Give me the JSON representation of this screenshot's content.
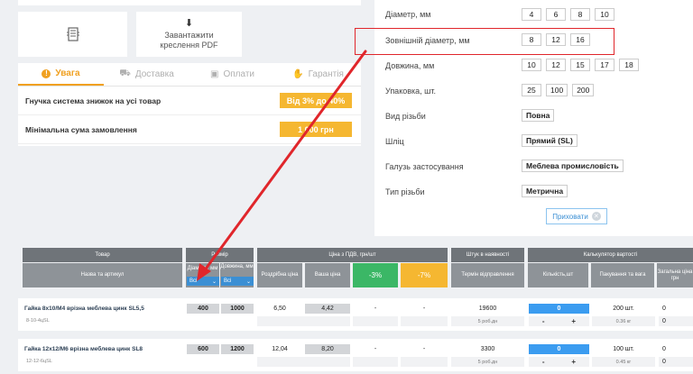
{
  "cards": {
    "pdf_icon": "⬇",
    "pdf_label": "Завантажити креслення PDF"
  },
  "tabs": [
    {
      "label": "Увага",
      "icon": "!"
    },
    {
      "label": "Доставка",
      "icon": "⛟"
    },
    {
      "label": "Оплати",
      "icon": "▣"
    },
    {
      "label": "Гарантія",
      "icon": "✋"
    }
  ],
  "info_rows": [
    {
      "label": "Гнучка система знижок на усі товар",
      "value": "Від 3% до 40%"
    },
    {
      "label": "Мінімальна сума замовлення",
      "value": "1 000 грн"
    }
  ],
  "filters": [
    {
      "label": "Діаметр, мм",
      "values": [
        "4",
        "6",
        "8",
        "10"
      ]
    },
    {
      "label": "Зовнішній діаметр, мм",
      "values": [
        "8",
        "12",
        "16"
      ]
    },
    {
      "label": "Довжина, мм",
      "values": [
        "10",
        "12",
        "15",
        "17",
        "18"
      ]
    },
    {
      "label": "Упаковка, шт.",
      "values": [
        "25",
        "100",
        "200"
      ]
    },
    {
      "label": "Вид різьби",
      "values": [
        "Повна"
      ]
    },
    {
      "label": "Шліц",
      "values": [
        "Прямий (SL)"
      ]
    },
    {
      "label": "Галузь застосування",
      "values": [
        "Меблева промисловість"
      ]
    },
    {
      "label": "Тип різьби",
      "values": [
        "Метрична"
      ]
    }
  ],
  "apply_label": "Приховати",
  "table": {
    "h_product": "Товар",
    "h_size": "Розмір",
    "h_price": "Ціна з ПДВ, грн/шт",
    "h_stock": "Штук в наявності",
    "h_calc": "Калькулятор вартості",
    "h_name": "Назва та артикул",
    "h_diam": "Діаметр, мм",
    "h_len": "Довжина, мм",
    "h_retail": "Роздрібна ціна",
    "h_your": "Ваша ціна",
    "h_minus3": "-3%",
    "h_minus7": "-7%",
    "h_ship": "Термін відправлення",
    "h_qty": "Кількість,шт",
    "h_pack": "Пакування та вага",
    "h_total": "Загальна ціна грн",
    "sel_all": "Всі"
  },
  "products": [
    {
      "name": "Гайка 8х10/М4 врізна меблева цинк SL5,5",
      "sku": "8-10-4цSL",
      "diam": "400",
      "len": "1000",
      "retail": "6,50",
      "your": "4,42",
      "d3": "-",
      "d7": "-",
      "stock": "19600",
      "ship": "5 роб.дн",
      "qty": "0",
      "pack": "200 шт.",
      "weight": "0.36 кг",
      "total": "0",
      "total2": "0"
    },
    {
      "name": "Гайка 12х12/М6 врізна меблева цинк SL8",
      "sku": "12-12-6цSL",
      "diam": "600",
      "len": "1200",
      "retail": "12,04",
      "your": "8,20",
      "d3": "-",
      "d7": "-",
      "stock": "3300",
      "ship": "5 роб.дн",
      "qty": "0",
      "pack": "100 шт.",
      "weight": "0.45 кг",
      "total": "0",
      "total2": "0"
    }
  ]
}
